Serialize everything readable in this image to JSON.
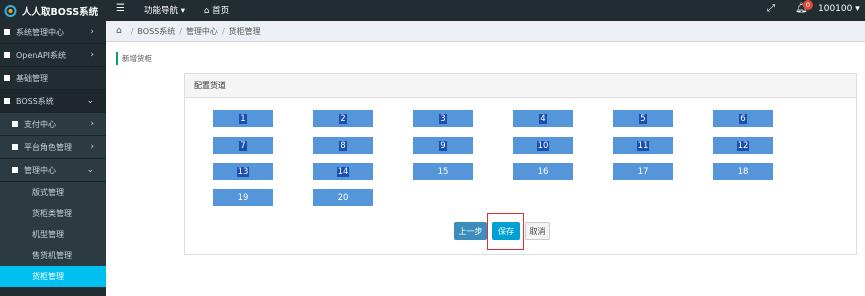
{
  "topbar": {
    "brand": "人人取BOSS系统",
    "menu_toggle_icon": "bars-icon",
    "nav_menu": "功能导航",
    "home": "首页",
    "notification_count": "0",
    "user": "100100"
  },
  "sidebar": {
    "items": [
      {
        "label": "系统管理中心"
      },
      {
        "label": "OpenAPI系统"
      },
      {
        "label": "基础管理"
      },
      {
        "label": "BOSS系统"
      },
      {
        "label": "支付中心"
      },
      {
        "label": "平台角色管理"
      },
      {
        "label": "管理中心"
      },
      {
        "label": "版式管理"
      },
      {
        "label": "货柜类管理"
      },
      {
        "label": "机型管理"
      },
      {
        "label": "售货机管理"
      },
      {
        "label": "货柜管理"
      }
    ]
  },
  "breadcrumb": [
    "BOSS系统",
    "管理中心",
    "货柜管理"
  ],
  "page_title": "新增货柜",
  "panel": {
    "title": "配置货道",
    "slots": [
      "1",
      "2",
      "3",
      "4",
      "5",
      "6",
      "7",
      "8",
      "9",
      "10",
      "11",
      "12",
      "13",
      "14",
      "15",
      "16",
      "17",
      "18",
      "19",
      "20"
    ]
  },
  "buttons": {
    "prev": "上一步",
    "save": "保存",
    "cancel": "取消"
  },
  "colors": {
    "sidebar_bg": "#222d32",
    "active_item": "#00c0ef",
    "slot_bg": "#5596da",
    "highlight": "#e03030"
  }
}
